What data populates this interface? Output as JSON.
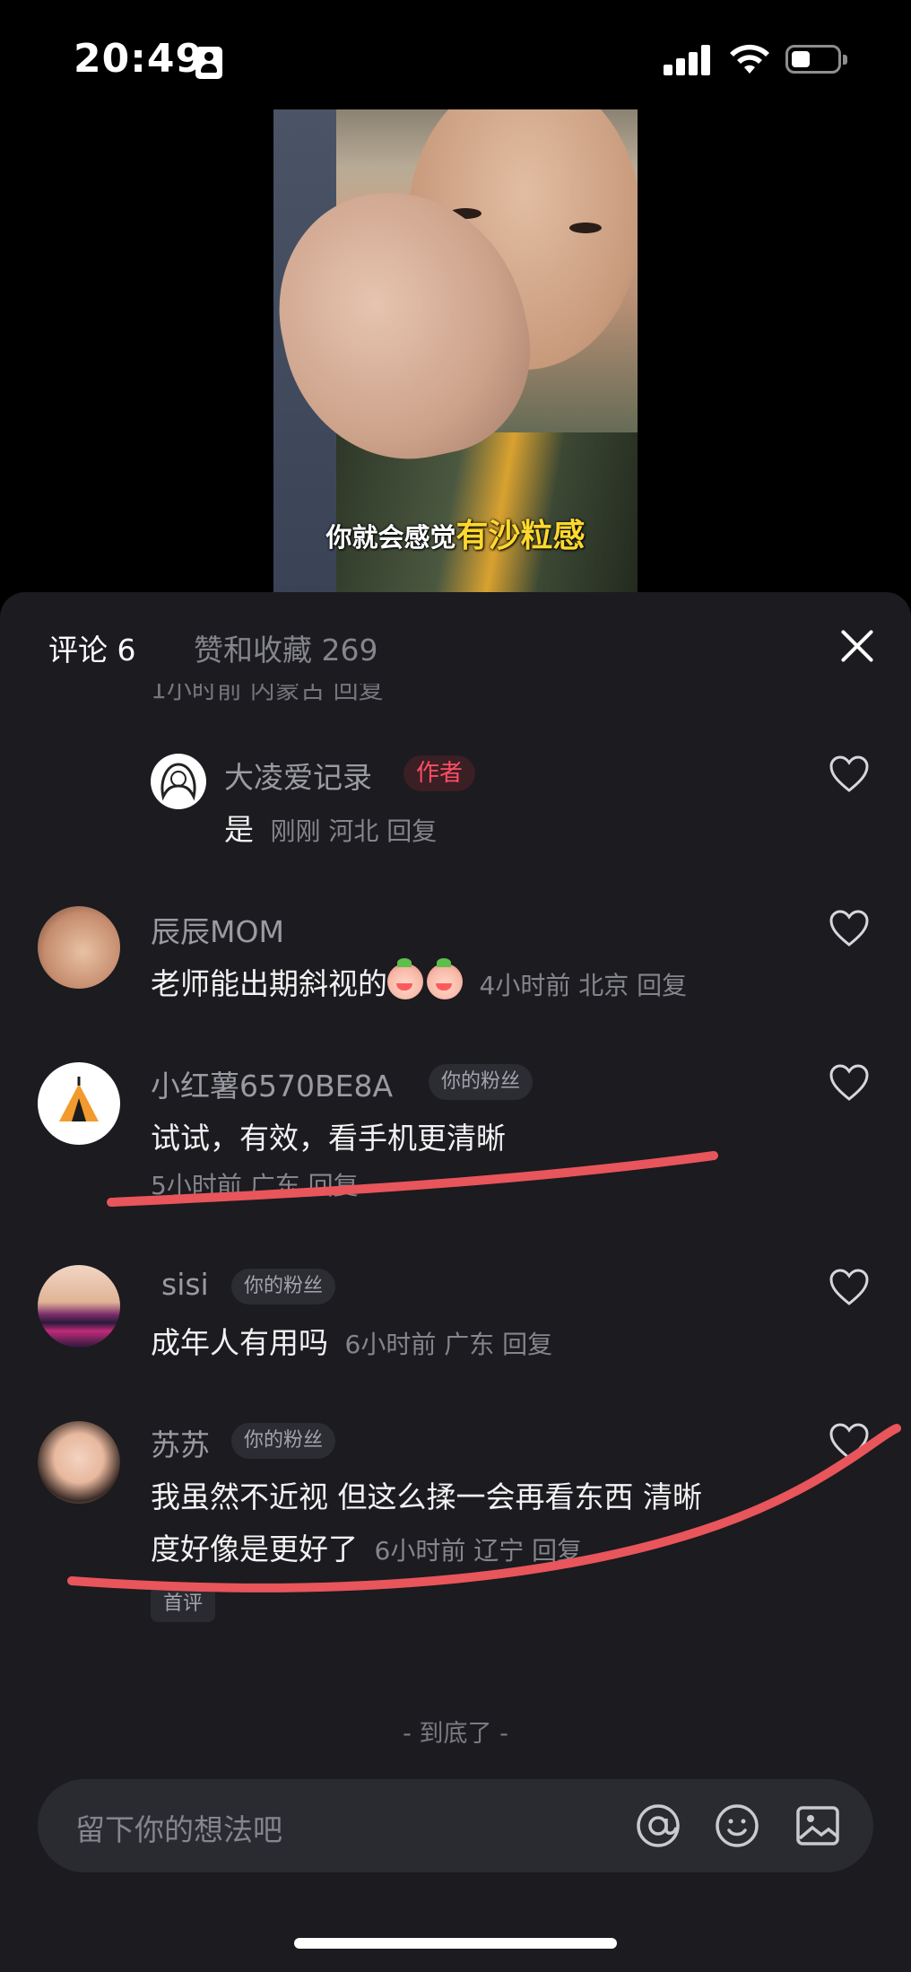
{
  "status_bar": {
    "time": "20:49"
  },
  "video": {
    "subtitle_prefix": "你就会感觉",
    "subtitle_highlight": "有沙粒感"
  },
  "sheet": {
    "tab_comments": "评论 6",
    "tab_likes": "赞和收藏 269",
    "ghost_line": "1小时前 内蒙古 回复",
    "end_marker": "- 到底了 -",
    "input_placeholder": "留下你的想法吧"
  },
  "comments": [
    {
      "username": "大凌爱记录",
      "badge": "作者",
      "text": "是",
      "meta": "刚刚 河北 回复"
    },
    {
      "username": "辰辰MOM",
      "text": "老师能出期斜视的",
      "meta": "4小时前 北京 回复"
    },
    {
      "username": "小红薯6570BE8A",
      "badge": "你的粉丝",
      "text": "试试，有效，看手机更清晰",
      "meta": "5小时前 广东 回复"
    },
    {
      "username": "sisi",
      "badge": "你的粉丝",
      "text": "成年人有用吗",
      "meta": "6小时前 广东 回复"
    },
    {
      "username": "苏苏",
      "badge": "你的粉丝",
      "text_line1": "我虽然不近视 但这么揉一会再看东西 清晰",
      "text_line2": "度好像是更好了",
      "meta": "6小时前 辽宁 回复",
      "tag": "首评"
    }
  ],
  "colors": {
    "sheet_bg": "#1b1b20",
    "annotation_red": "#e8555a",
    "author_badge": "#ff4d63",
    "subtitle_highlight": "#ffd82e"
  }
}
